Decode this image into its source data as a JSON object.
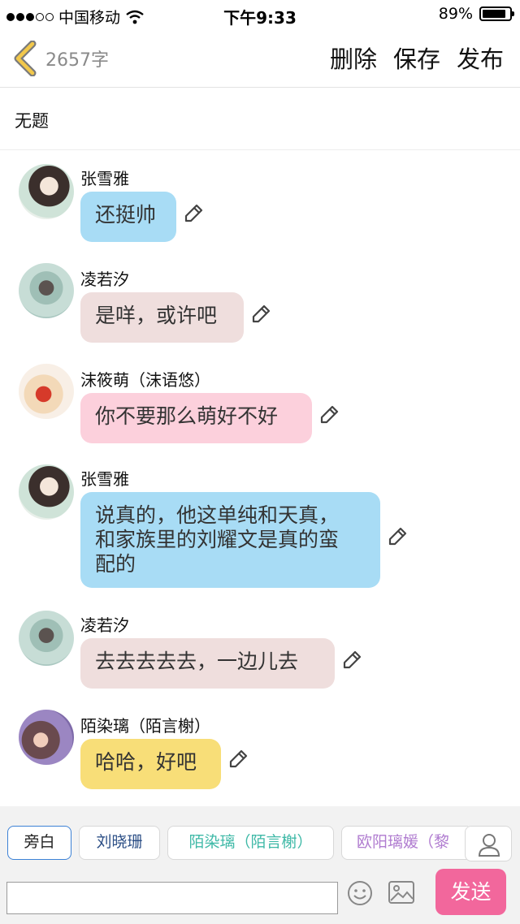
{
  "status_bar": {
    "carrier": "中国移动",
    "time": "下午9:33",
    "battery": "89%",
    "battery_level": 0.89
  },
  "nav": {
    "back_icon": "chevron-left-icon",
    "word_count": "2657字",
    "delete_label": "删除",
    "save_label": "保存",
    "publish_label": "发布",
    "accent_color": "#f2c84b"
  },
  "title": "无题",
  "messages": [
    {
      "sender": "张雪雅",
      "text": "还挺帅",
      "bubble_color": "#a8dcf5"
    },
    {
      "sender": "凌若汐",
      "text": "是咩，或许吧",
      "bubble_color": "#efdedd"
    },
    {
      "sender": "沫筱萌（沫语悠）",
      "text": "你不要那么萌好不好",
      "bubble_color": "#fcd0dc"
    },
    {
      "sender": "张雪雅",
      "text": "说真的，他这单纯和天真，\n和家族里的刘耀文是真的蛮\n配的",
      "bubble_color": "#a8dcf5"
    },
    {
      "sender": "凌若汐",
      "text": "去去去去去，一边儿去",
      "bubble_color": "#efdedd"
    },
    {
      "sender": "陌染璃（陌言榭）",
      "text": "哈哈，好吧",
      "bubble_color": "#f8de78"
    }
  ],
  "characters": [
    {
      "label": "旁白",
      "color": "#222222",
      "active": true
    },
    {
      "label": "刘晓珊",
      "color": "#2c4f86"
    },
    {
      "label": "陌染璃（陌言榭）",
      "color": "#3fb9a7"
    },
    {
      "label": "欧阳璃媛（黎",
      "color": "#b07cd0"
    }
  ],
  "composer": {
    "input_value": "",
    "send_label": "发送",
    "send_color": "#f2679c"
  }
}
